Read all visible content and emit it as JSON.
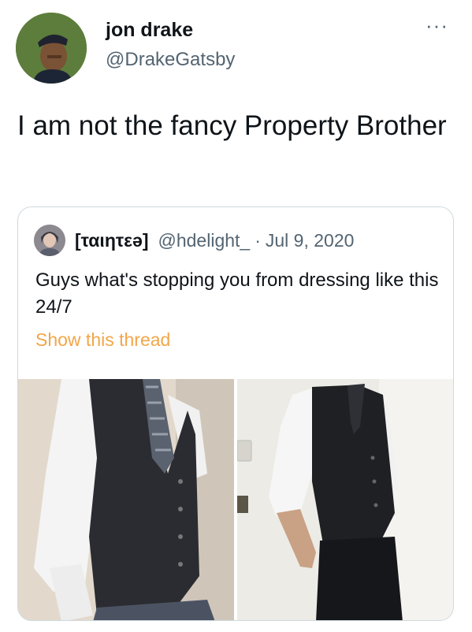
{
  "tweet": {
    "author": {
      "name": "jon drake",
      "handle": "@DrakeGatsby"
    },
    "more_icon": "more-options-icon",
    "text": "I am not the fancy Property Brother"
  },
  "quote": {
    "author": {
      "name": "[ταιητεә]",
      "handle": "@hdelight_"
    },
    "separator": "·",
    "date": "Jul 9, 2020",
    "text": "Guys what's stopping you from dressing like this 24/7",
    "show_thread": "Show this thread",
    "link_color": "#f2a64a"
  }
}
